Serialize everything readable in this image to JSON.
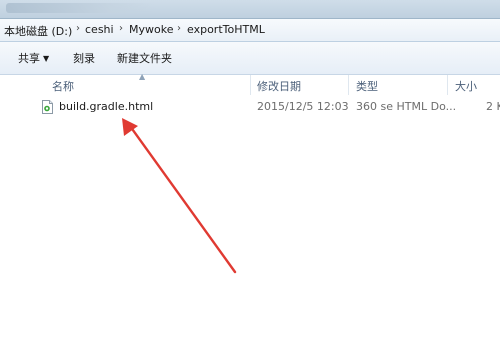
{
  "address": {
    "crumbs": [
      "本地磁盘 (D:)",
      "ceshi",
      "Mywoke",
      "exportToHTML"
    ],
    "separator": "›"
  },
  "toolbar": {
    "share_label": "共享",
    "burn_label": "刻录",
    "new_folder_label": "新建文件夹"
  },
  "columns": {
    "name": "名称",
    "modified": "修改日期",
    "type": "类型",
    "size": "大小"
  },
  "files": [
    {
      "name": "build.gradle.html",
      "modified": "2015/12/5 12:03",
      "type": "360 se HTML Do...",
      "size": "2 K"
    }
  ],
  "icons": {
    "file": "html-file-icon",
    "share_dropdown": "chevron-down-icon",
    "sort": "sort-up-icon",
    "annotation": "red-arrow-annotation"
  },
  "colors": {
    "arrow": "#e03a32",
    "header_text": "#4c607a"
  }
}
